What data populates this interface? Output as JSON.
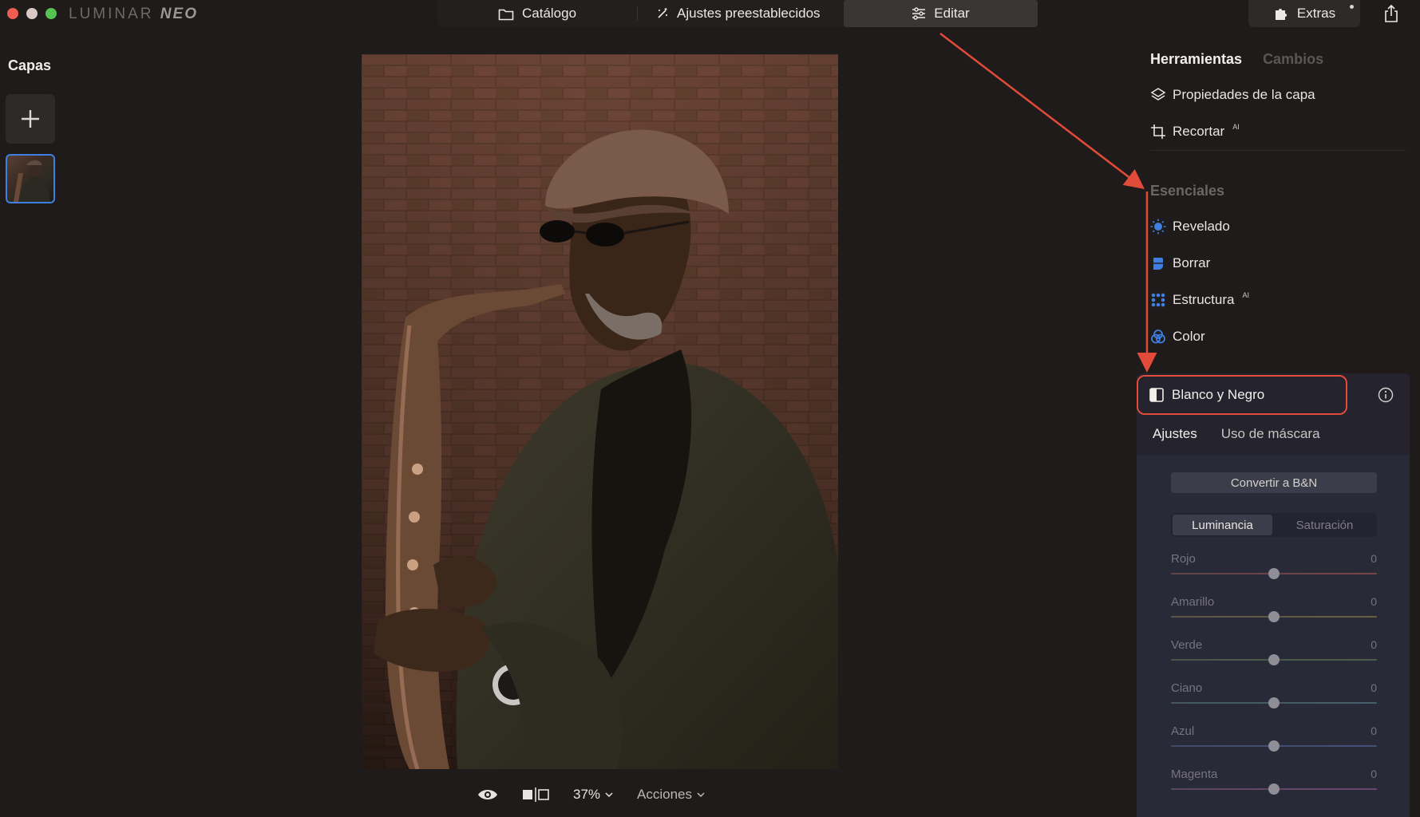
{
  "app": {
    "logo_light": "LUMINAR",
    "logo_bold": "NEO"
  },
  "top_tabs": {
    "catalog": "Catálogo",
    "presets": "Ajustes preestablecidos",
    "edit": "Editar",
    "extras": "Extras"
  },
  "layers": {
    "title": "Capas"
  },
  "bottom": {
    "zoom": "37%",
    "actions": "Acciones"
  },
  "tools": {
    "tab_tools": "Herramientas",
    "tab_changes": "Cambios",
    "layer_properties": "Propiedades de la capa",
    "crop": "Recortar",
    "ai_badge": "AI",
    "section_essentials": "Esenciales",
    "develop": "Revelado",
    "erase": "Borrar",
    "structure": "Estructura",
    "color": "Color"
  },
  "bw": {
    "title": "Blanco y Negro",
    "subtab_adjust": "Ajustes",
    "subtab_mask": "Uso de máscara",
    "convert": "Convertir a B&N",
    "seg_luminance": "Luminancia",
    "seg_saturation": "Saturación",
    "sliders": [
      {
        "label": "Rojo",
        "value": "0"
      },
      {
        "label": "Amarillo",
        "value": "0"
      },
      {
        "label": "Verde",
        "value": "0"
      },
      {
        "label": "Ciano",
        "value": "0"
      },
      {
        "label": "Azul",
        "value": "0"
      },
      {
        "label": "Magenta",
        "value": "0"
      }
    ]
  },
  "colors": {
    "accent_blue": "#3f7fe0",
    "annotation_red": "#e24a3a"
  }
}
